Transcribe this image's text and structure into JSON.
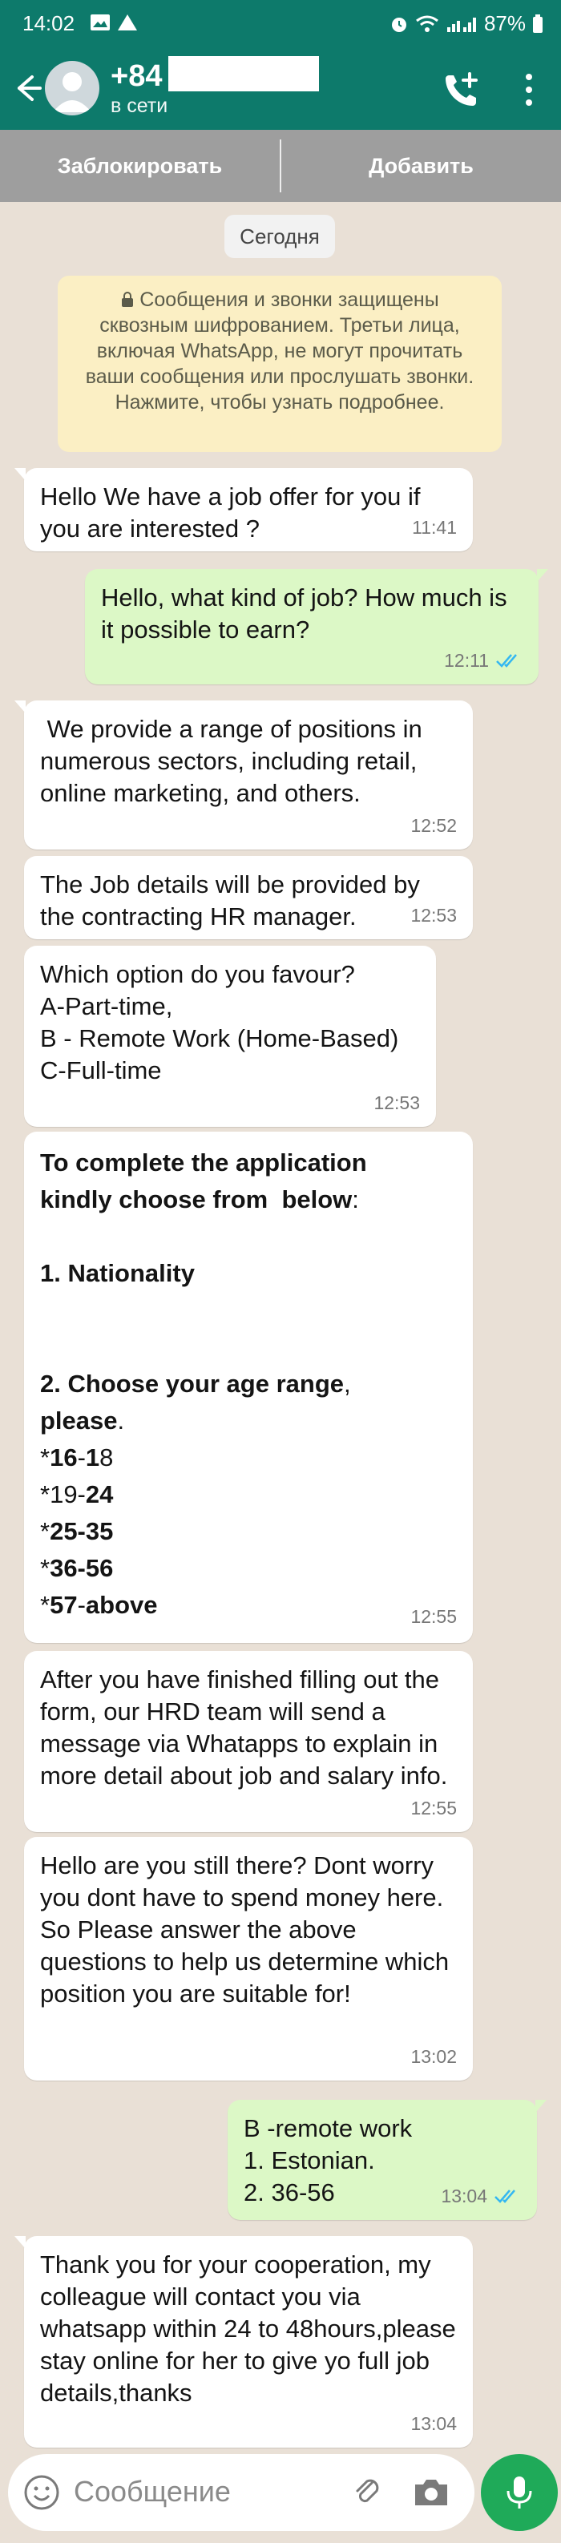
{
  "status_bar": {
    "time": "14:02",
    "battery": "87%"
  },
  "header": {
    "contact_prefix": "+84",
    "status": "в сети"
  },
  "actions": {
    "block": "Заблокировать",
    "add": "Добавить"
  },
  "date_chip": "Сегодня",
  "encryption_notice": "Сообщения и звонки защищены сквозным шифрованием. Третьи лица, включая WhatsApp, не могут прочитать ваши сообщения или прослушать звонки. Нажмите, чтобы узнать подробнее.",
  "messages": [
    {
      "dir": "in",
      "time": "11:41",
      "text": "Hello We have a job offer for you if you are interested ?"
    },
    {
      "dir": "out",
      "time": "12:11",
      "text": "Hello, what kind of job? How much is it possible to earn?"
    },
    {
      "dir": "in",
      "time": "12:52",
      "text": " We provide a range of positions in numerous sectors, including retail, online marketing, and others."
    },
    {
      "dir": "in",
      "time": "12:53",
      "text": "The Job details will be provided by the contracting HR manager."
    },
    {
      "dir": "in",
      "time": "12:53",
      "text": "Which option do you favour?\nA-Part-time,\nB - Remote Work (Home-Based)\nC-Full-time"
    },
    {
      "dir": "in",
      "time": "12:55",
      "parts": {
        "heading_1": "To complete the application",
        "heading_2a": "kindly choose from  below",
        "heading_2b": ":",
        "item1_num": "1",
        "item1_text": ". Nationality",
        "item2_num": "2",
        "item2_text": ". Choose your age range",
        "item2_comma": ",",
        "item2_please": "please",
        "item2_dot": ".",
        "r1_star": "*",
        "r1_b": "16",
        "r1_dash": "-",
        "r1_b2": "1",
        "r1_n": "8",
        "r2_star": "*",
        "r2_n": "19-",
        "r2_b": "24",
        "r3_star": "*",
        "r3_b": "25-35",
        "r4_star": "*",
        "r4_b": "36-56",
        "r5_star": "*",
        "r5_b": "57",
        "r5_dash": "-",
        "r5_b2": "above"
      }
    },
    {
      "dir": "in",
      "time": "12:55",
      "text": "After you have finished filling out the form, our HRD team will send a message via Whatapps to explain in more detail about job and salary info."
    },
    {
      "dir": "in",
      "time": "13:02",
      "text": "Hello are you still there? Dont worry you dont have to spend money here. So Please answer the above questions to help us determine which position you are suitable for!"
    },
    {
      "dir": "out",
      "time": "13:04",
      "text": "B -remote work\n1. Estonian.\n2. 36-56"
    },
    {
      "dir": "in",
      "time": "13:04",
      "text": "Thank you for your cooperation, my colleague will contact you via whatsapp within 24 to 48hours,please stay online for her to give yo full job details,thanks"
    }
  ],
  "composer": {
    "placeholder": "Сообщение"
  },
  "colors": {
    "header": "#0d7a6b",
    "outgoing": "#dcf8c6",
    "incoming": "#ffffff",
    "mic": "#1faa59",
    "ticks": "#34b7f1"
  }
}
